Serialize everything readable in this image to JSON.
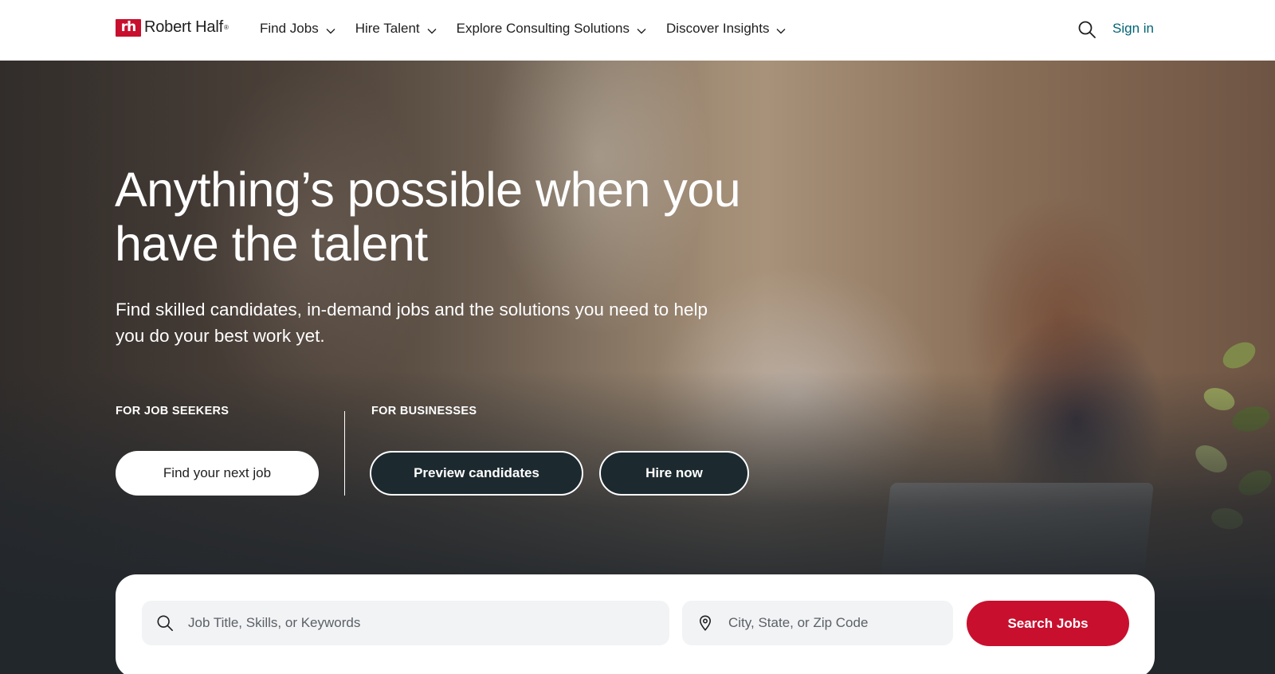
{
  "brand": {
    "logo_mark": "rh",
    "name": "Robert Half",
    "reg": "®",
    "color": "#c8102e"
  },
  "nav": {
    "items": [
      {
        "label": "Find Jobs",
        "icon": "chevron-down-icon"
      },
      {
        "label": "Hire Talent",
        "icon": "chevron-down-icon"
      },
      {
        "label": "Explore Consulting Solutions",
        "icon": "chevron-down-icon"
      },
      {
        "label": "Discover Insights",
        "icon": "chevron-down-icon"
      }
    ],
    "search_icon": "search-icon",
    "sign_in": "Sign in",
    "sign_in_color": "#006475"
  },
  "hero": {
    "headline": "Anything’s possible when you have the talent",
    "subtext": "Find skilled candidates, in-demand jobs and the solutions you need to help you do your best work yet.",
    "job_seekers": {
      "label": "FOR JOB SEEKERS",
      "button": "Find your next job"
    },
    "businesses": {
      "label": "FOR BUSINESSES",
      "buttons": [
        "Preview candidates",
        "Hire now"
      ]
    }
  },
  "search": {
    "keyword_placeholder": "Job Title, Skills, or Keywords",
    "keyword_value": "",
    "location_placeholder": "City, State, or Zip Code",
    "location_value": "",
    "keyword_icon": "search-icon",
    "location_icon": "location-pin-icon",
    "button": "Search Jobs",
    "button_color": "#c8102e"
  }
}
